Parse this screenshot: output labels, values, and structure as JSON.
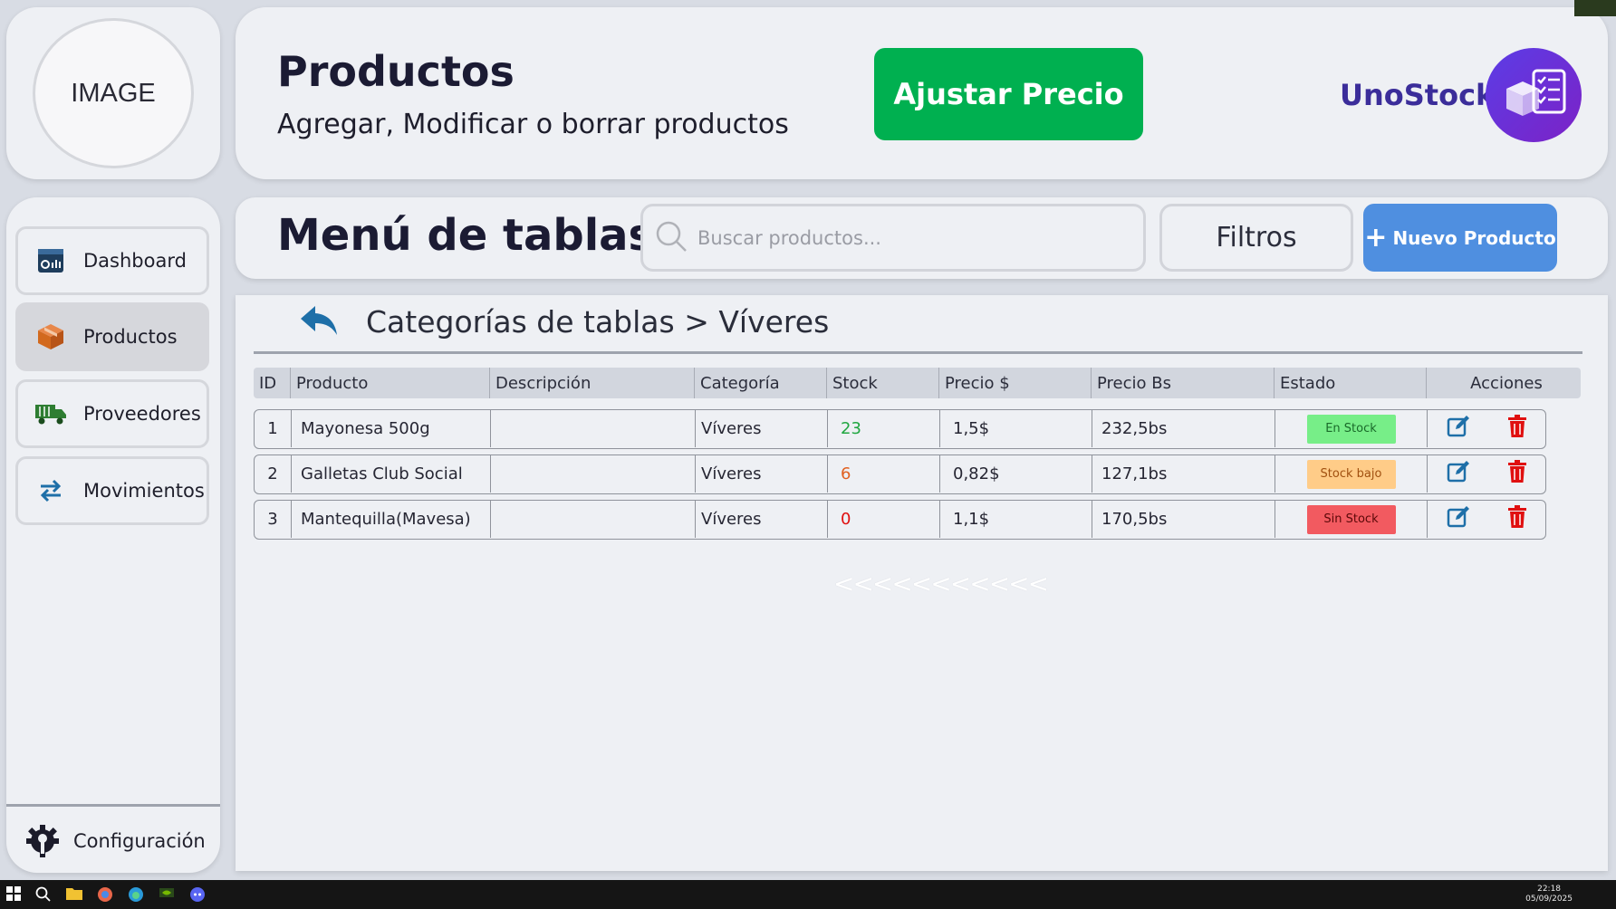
{
  "logo_placeholder": "IMAGE",
  "header": {
    "title": "Productos",
    "subtitle": "Agregar, Modificar o borrar productos",
    "adjust_price_label": "Ajustar Precio",
    "brand_name": "UnoStock"
  },
  "sidebar": {
    "items": [
      {
        "label": "Dashboard",
        "icon": "dashboard-icon",
        "active": false
      },
      {
        "label": "Productos",
        "icon": "box-icon",
        "active": true
      },
      {
        "label": "Proveedores",
        "icon": "truck-icon",
        "active": false
      },
      {
        "label": "Movimientos",
        "icon": "swap-arrows-icon",
        "active": false
      }
    ],
    "settings_label": "Configuración"
  },
  "toolbar": {
    "title": "Menú de tablas",
    "search_placeholder": "Buscar productos...",
    "filters_label": "Filtros",
    "new_product_label": "Nuevo Producto"
  },
  "breadcrumb": "Categorías de tablas > Víveres",
  "table": {
    "columns": [
      "ID",
      "Producto",
      "Descripción",
      "Categoría",
      "Stock",
      "Precio $",
      "Precio Bs",
      "Estado",
      "Acciones"
    ],
    "rows": [
      {
        "id": "1",
        "product": "Mayonesa 500g",
        "description": "",
        "category": "Víveres",
        "stock": "23",
        "price_usd": "1,5$",
        "price_bs": "232,5bs",
        "status": "En Stock",
        "status_kind": "ok"
      },
      {
        "id": "2",
        "product": "Galletas Club Social",
        "description": "",
        "category": "Víveres",
        "stock": "6",
        "price_usd": "0,82$",
        "price_bs": "127,1bs",
        "status": "Stock bajo",
        "status_kind": "low"
      },
      {
        "id": "3",
        "product": "Mantequilla(Mavesa)",
        "description": "",
        "category": "Víveres",
        "stock": "0",
        "price_usd": "1,1$",
        "price_bs": "170,5bs",
        "status": "Sin Stock",
        "status_kind": "none"
      }
    ]
  },
  "pager": "<<<<<<<<<<<",
  "taskbar": {
    "time": "22:18",
    "date": "05/09/2025"
  },
  "colors": {
    "accent_green": "#00b050",
    "accent_blue": "#4f8fe0",
    "brand_purple": "#5b3de6",
    "stock_ok": "#20a640",
    "stock_low": "#e06020",
    "stock_none": "#e01010"
  }
}
